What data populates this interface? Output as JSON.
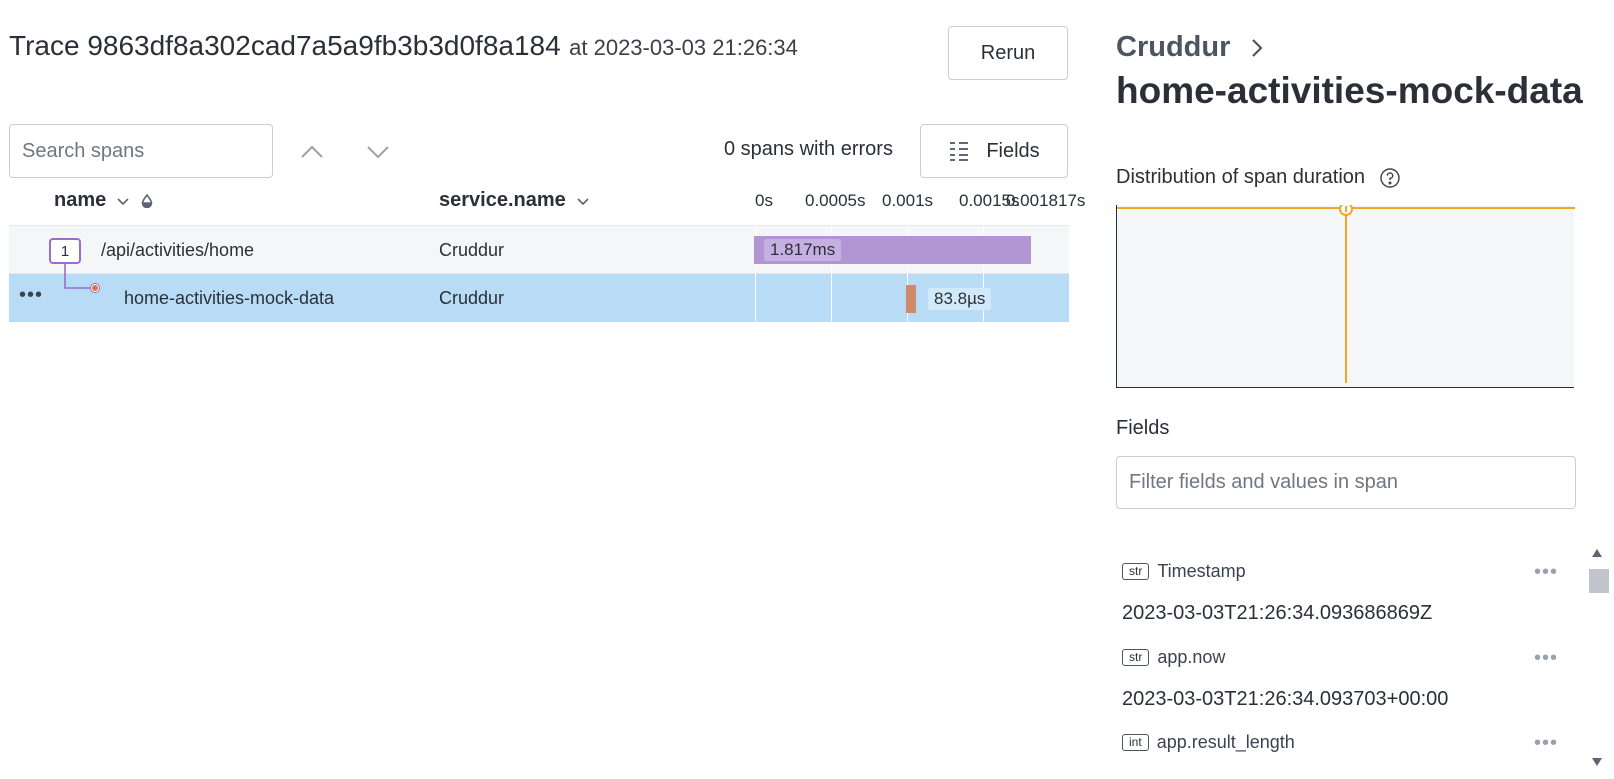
{
  "trace": {
    "label": "Trace 9863df8a302cad7a5a9fb3b3d0f8a184",
    "at": "at 2023-03-03 21:26:34",
    "rerun_label": "Rerun"
  },
  "toolbar": {
    "search_placeholder": "Search spans",
    "errors_text": "0 spans with errors",
    "fields_label": "Fields"
  },
  "columns": {
    "name": "name",
    "service": "service.name"
  },
  "timeline": {
    "ticks": [
      "0s",
      "0.0005s",
      "0.001s",
      "0.0015s",
      "0.001817s"
    ],
    "total_duration_s": 0.001817
  },
  "spans": [
    {
      "count": "1",
      "name": "/api/activities/home",
      "service": "Cruddur",
      "duration_label": "1.817ms",
      "start_s": 0.0,
      "duration_s": 0.001817,
      "color": "#b196d3"
    },
    {
      "name": "home-activities-mock-data",
      "service": "Cruddur",
      "duration_label": "83.8µs",
      "start_s": 0.001,
      "duration_s": 8.38e-05,
      "color": "#cf8a6c",
      "selected": true
    }
  ],
  "detail": {
    "service": "Cruddur",
    "span_name": "home-activities-mock-data",
    "distribution_title": "Distribution of span duration",
    "fields_title": "Fields",
    "filter_placeholder": "Filter fields and values in span",
    "fields": [
      {
        "type": "str",
        "name": "Timestamp",
        "value": "2023-03-03T21:26:34.093686869Z"
      },
      {
        "type": "str",
        "name": "app.now",
        "value": "2023-03-03T21:26:34.093703+00:00"
      },
      {
        "type": "int",
        "name": "app.result_length",
        "value": ""
      }
    ]
  },
  "colors": {
    "accent_orange": "#f5a623",
    "selected_row": "#b8dcf5",
    "root_bar": "#b196d3",
    "child_bar": "#cf8a6c"
  }
}
